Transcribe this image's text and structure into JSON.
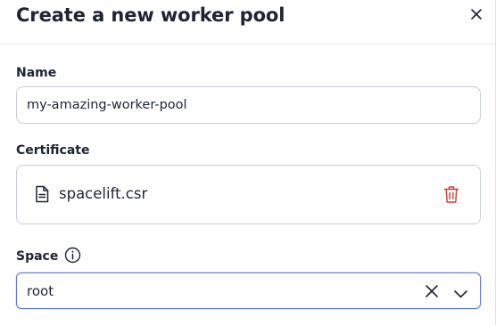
{
  "dialog": {
    "title": "Create a new worker pool"
  },
  "form": {
    "name": {
      "label": "Name",
      "value": "my-amazing-worker-pool"
    },
    "certificate": {
      "label": "Certificate",
      "file_name": "spacelift.csr"
    },
    "space": {
      "label": "Space",
      "selected_value": "root"
    }
  },
  "icons": {
    "close": "close-icon",
    "file": "file-icon",
    "delete": "trash-icon",
    "info": "info-icon",
    "clear": "clear-icon",
    "dropdown": "chevron-down-icon"
  },
  "colors": {
    "text": "#1e2433",
    "border": "#c9ced6",
    "focus_border": "#5b7bd5",
    "danger": "#c2473c"
  }
}
